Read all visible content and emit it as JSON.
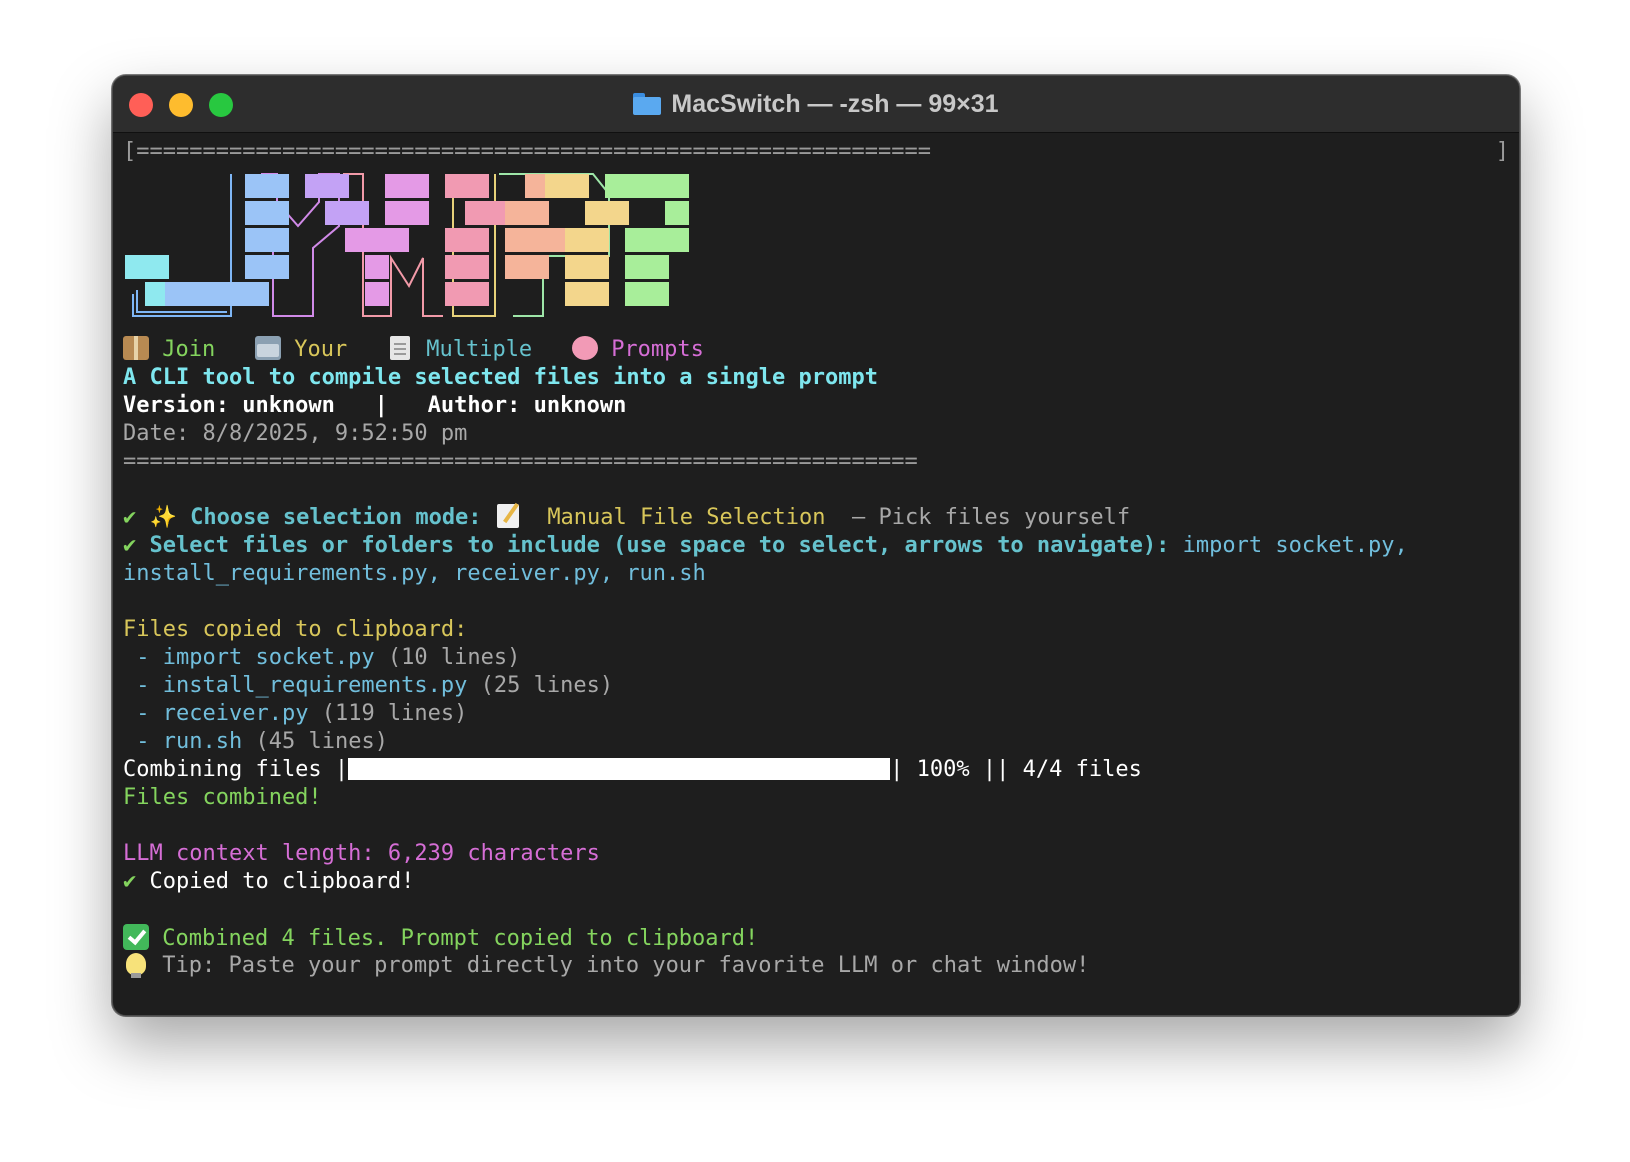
{
  "window": {
    "title": "MacSwitch — -zsh — 99×31"
  },
  "banner": {
    "rule": "============================================================",
    "rule_left_bracket": "[",
    "rule_right_bracket": "]",
    "tagline": [
      {
        "icon": "package-icon",
        "text": "Join"
      },
      {
        "icon": "folder-icon",
        "text": "Your"
      },
      {
        "icon": "document-icon",
        "text": "Multiple"
      },
      {
        "icon": "brain-icon",
        "text": "Prompts"
      }
    ],
    "description": "A CLI tool to compile selected files into a single prompt",
    "version_line": "Version: unknown   |   Author: unknown",
    "date_line": "Date: 8/8/2025, 9:52:50 pm"
  },
  "prompts": {
    "mode_check": "✔",
    "mode_question": "Choose selection mode:",
    "mode_answer": "Manual File Selection",
    "mode_hint": " – Pick files yourself",
    "files_check": "✔",
    "files_question": "Select files or folders to include (use space to select, arrows to navigate):",
    "files_answer_1": "import socket.py,",
    "files_answer_2": "install_requirements.py, receiver.py, run.sh"
  },
  "copied": {
    "heading": "Files copied to clipboard:",
    "files": [
      {
        "name": "import socket.py",
        "lines": "(10 lines)"
      },
      {
        "name": "install_requirements.py",
        "lines": "(25 lines)"
      },
      {
        "name": "receiver.py",
        "lines": "(119 lines)"
      },
      {
        "name": "run.sh",
        "lines": "(45 lines)"
      }
    ]
  },
  "progress": {
    "label": "Combining files |",
    "percent_value": 1.0,
    "suffix": "| 100% || 4/4 files",
    "done": "Files combined!"
  },
  "summary": {
    "context_length": "LLM context length: 6,239 characters",
    "copied_check": "✔",
    "copied_text": "Copied to clipboard!",
    "combined": "Combined 4 files. Prompt copied to clipboard!",
    "tip": "Tip: Paste your prompt directly into your favorite LLM or chat window!"
  },
  "colors": {
    "terminal_bg": "#1e1e1e",
    "cyan": "#7ee6ee",
    "yellow": "#d8c65a",
    "green": "#84d45e",
    "magenta": "#d66ed6"
  }
}
